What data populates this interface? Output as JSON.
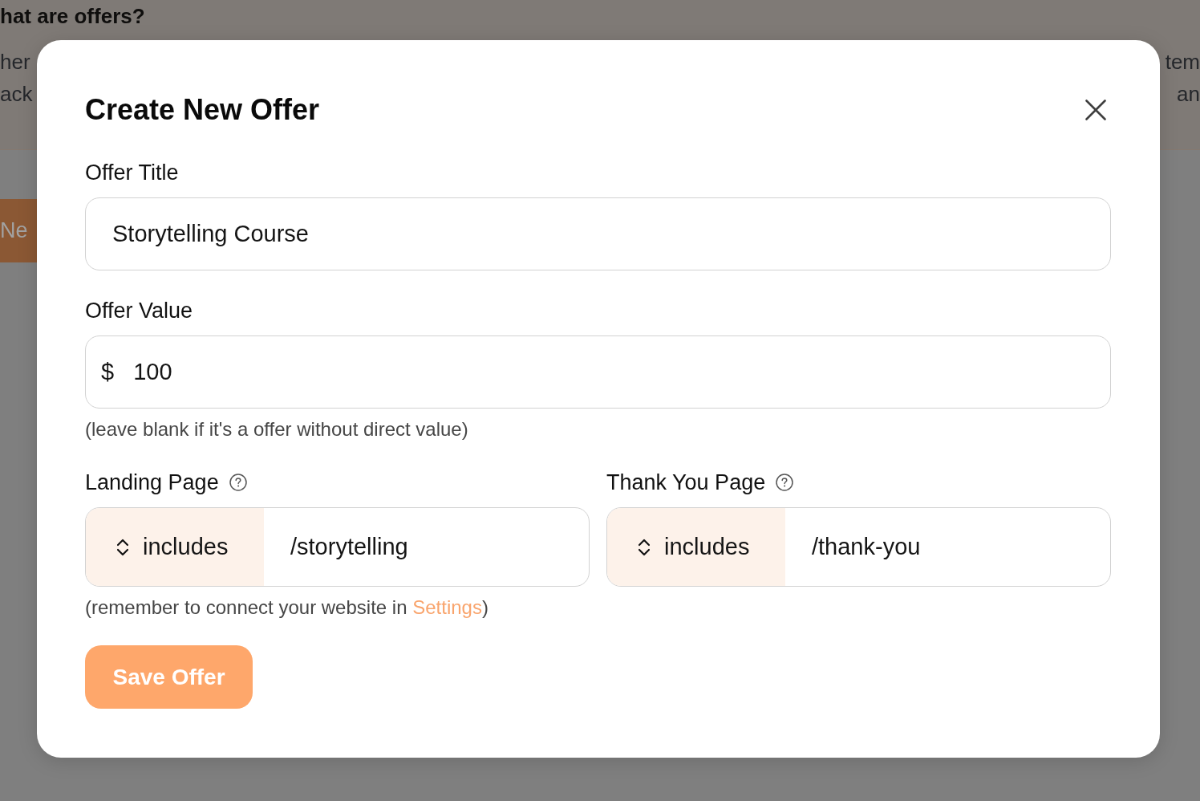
{
  "background_page": {
    "heading": "hat are offers?",
    "left_fragments": [
      "her",
      "ack"
    ],
    "right_fragments": [
      "tem",
      "an"
    ],
    "button": "Ne"
  },
  "dialog": {
    "title": "Create New Offer",
    "fields": [
      {
        "kind": "text",
        "label": "Offer Title",
        "value": "Storytelling Course"
      },
      {
        "kind": "currency",
        "label": "Offer Value",
        "prefix": "$",
        "value": "100",
        "hint": "(leave blank if it's a offer without direct value)"
      }
    ],
    "page_rules": [
      {
        "label": "Landing Page",
        "operator": "includes",
        "value": "/storytelling"
      },
      {
        "label": "Thank You Page",
        "operator": "includes",
        "value": "/thank-you"
      }
    ],
    "rules_hint": {
      "text": "(remember to connect your website in ",
      "link": "Settings",
      "end": ")"
    },
    "save_button": "Save Offer"
  }
}
